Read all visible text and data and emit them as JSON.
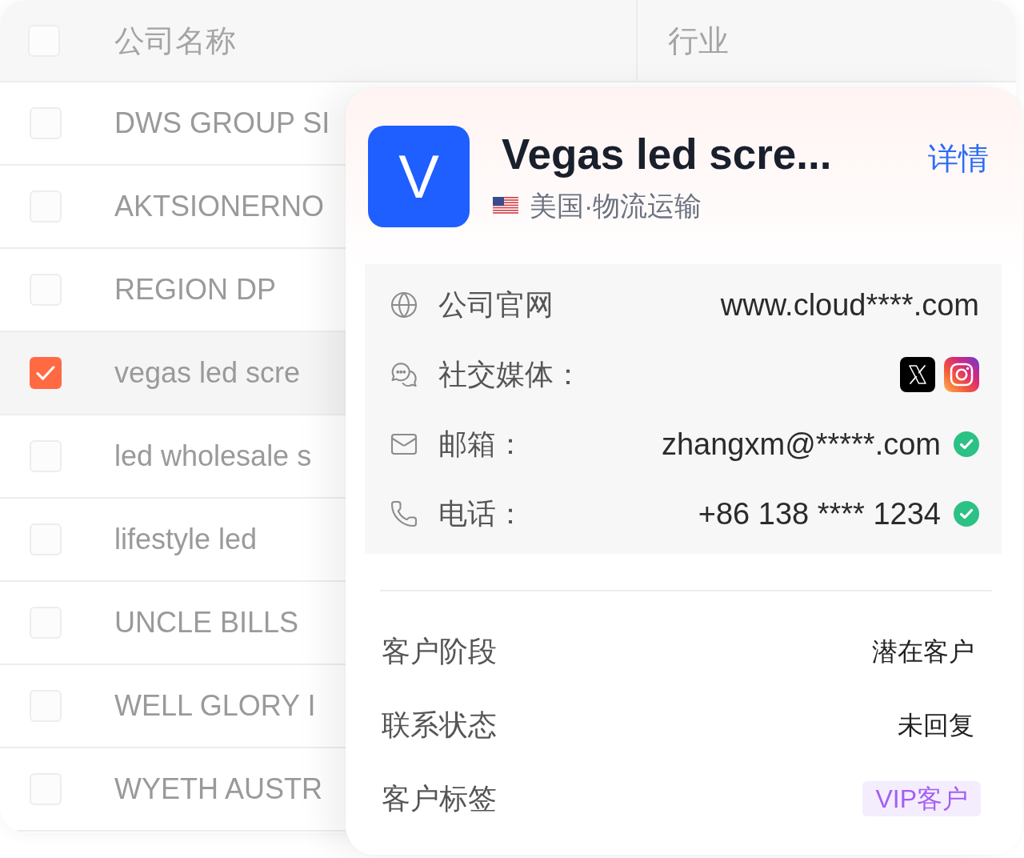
{
  "table": {
    "header_checkbox": {
      "checked": false
    },
    "columns": [
      "公司名称",
      "行业"
    ],
    "rows": [
      {
        "name": "DWS GROUP SI",
        "checked": false
      },
      {
        "name": "AKTSIONERNO",
        "checked": false
      },
      {
        "name": "REGION DP",
        "checked": false
      },
      {
        "name": "vegas led scre",
        "checked": true
      },
      {
        "name": "led wholesale s",
        "checked": false
      },
      {
        "name": "lifestyle led",
        "checked": false
      },
      {
        "name": "UNCLE BILLS",
        "checked": false
      },
      {
        "name": "WELL GLORY I",
        "checked": false
      },
      {
        "name": "WYETH AUSTR",
        "checked": false
      }
    ]
  },
  "card": {
    "avatar_letter": "V",
    "title": "Vegas led scre...",
    "details_link": "详情",
    "location": "美国·物流运输",
    "contacts": [
      {
        "kind": "text",
        "label": "公司官网",
        "value": "www.cloud****.com",
        "verified": false
      },
      {
        "kind": "socials",
        "label": "社交媒体：",
        "socials": [
          {
            "kind": "x"
          },
          {
            "kind": "instagram"
          }
        ]
      },
      {
        "kind": "text",
        "label": "邮箱：",
        "value": "zhangxm@*****.com",
        "verified": true
      },
      {
        "kind": "text",
        "label": "电话：",
        "value": "+86 138 **** 1234",
        "verified": true
      }
    ],
    "fields": [
      {
        "kind": "text",
        "label": "客户阶段",
        "value": "潜在客户"
      },
      {
        "kind": "text",
        "label": "联系状态",
        "value": "未回复"
      },
      {
        "kind": "tag",
        "label": "客户标签",
        "value": "VIP客户"
      }
    ]
  }
}
